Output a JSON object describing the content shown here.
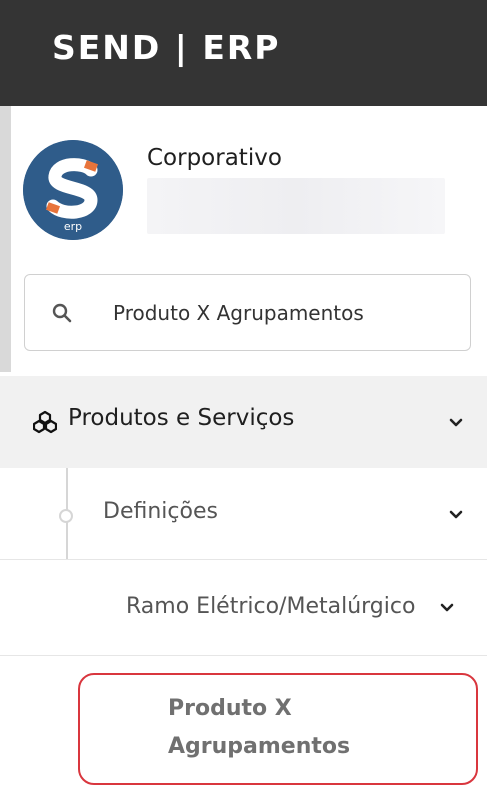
{
  "app": {
    "title": "SEND | ERP"
  },
  "user": {
    "company": "Corporativo",
    "avatar_text": "erp"
  },
  "search": {
    "value": "Produto X Agrupamentos",
    "placeholder": ""
  },
  "menu": {
    "level1": {
      "label": "Produtos e Serviços",
      "icon": "cubes-icon"
    },
    "level2": {
      "label": "Definições"
    },
    "level3": {
      "label": "Ramo Elétrico/Metalúrgico"
    },
    "level4": {
      "label_line1": "Produto X",
      "label_line2": "Agrupamentos"
    }
  },
  "colors": {
    "header_bg": "#343434",
    "highlight_border": "#d9363e",
    "logo_blue": "#2f5c8a",
    "logo_orange": "#e8743b"
  }
}
